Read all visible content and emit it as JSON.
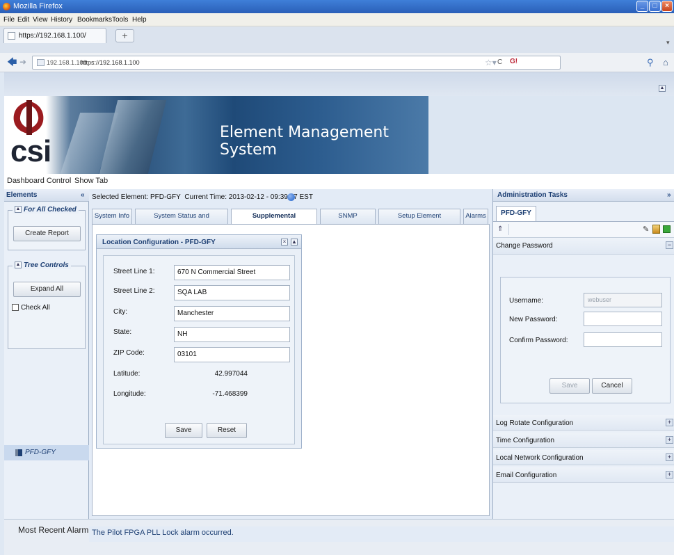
{
  "browser": {
    "window_title": "Mozilla Firefox",
    "menu": [
      "File",
      "Edit",
      "View",
      "History",
      "Bookmarks",
      "Tools",
      "Help"
    ],
    "tab_label": "https://192.168.1.100/",
    "new_tab": "+",
    "site_domain": "192.168.1.100",
    "url": "https://192.168.1.100",
    "search_engine": "G!"
  },
  "app": {
    "logo": "csi",
    "banner_title": "Element Management System",
    "menu": [
      "Dashboard Control",
      "Show Tab"
    ]
  },
  "elements_panel": {
    "title": "Elements",
    "for_all_checked": "For All Checked",
    "create_report": "Create Report",
    "tree_controls": "Tree Controls",
    "expand_all": "Expand All",
    "check_all": "Check All",
    "tree_node": "PFD-GFY"
  },
  "center": {
    "selected_label": "Selected Element:",
    "selected_value": "PFD-GFY",
    "time_label": "Current Time:",
    "time_value": "2013-02-12 - 09:39:17 EST",
    "tabs": [
      "System Info",
      "System Status and Configuration",
      "Supplemental Configuration",
      "SNMP Configuration",
      "Setup Element Configuration",
      "Alarms"
    ],
    "location": {
      "title": "Location Configuration - PFD-GFY",
      "street1_label": "Street Line 1:",
      "street1_value": "670 N Commercial Street",
      "street2_label": "Street Line 2:",
      "street2_value": "SQA LAB",
      "city_label": "City:",
      "city_value": "Manchester",
      "state_label": "State:",
      "state_value": "NH",
      "zip_label": "ZIP Code:",
      "zip_value": "03101",
      "lat_label": "Latitude:",
      "lat_value": "42.997044",
      "lon_label": "Longitude:",
      "lon_value": "-71.468399",
      "save": "Save",
      "reset": "Reset"
    }
  },
  "admin": {
    "title": "Administration Tasks",
    "tab": "PFD-GFY",
    "change_password": "Change Password",
    "username_label": "Username:",
    "username_value": "webuser",
    "new_password_label": "New Password:",
    "confirm_password_label": "Confirm Password:",
    "save": "Save",
    "cancel": "Cancel",
    "sections": [
      "Log Rotate Configuration",
      "Time Configuration",
      "Local Network Configuration",
      "Email Configuration"
    ]
  },
  "status": {
    "label": "Most Recent Alarm:",
    "message": "The Pilot FPGA PLL Lock alarm occurred."
  },
  "colors": {
    "accent": "#1d3f73",
    "header_bg": "#dce6f2",
    "titlebar": "#2a5fb8"
  }
}
